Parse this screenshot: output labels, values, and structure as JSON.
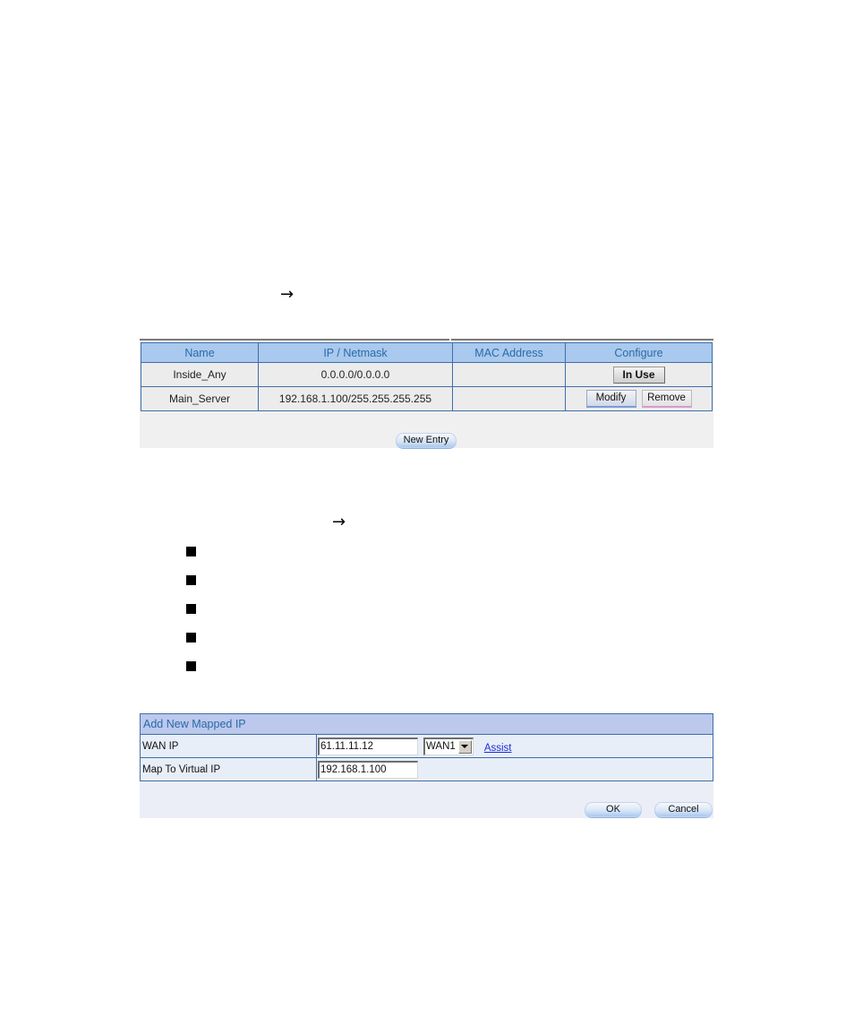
{
  "document": {
    "arrow_1": "→",
    "arrow_2": "→",
    "bullet_count": 5
  },
  "address_table": {
    "columns": [
      "Name",
      "IP / Netmask",
      "MAC Address",
      "Configure"
    ],
    "rows": [
      {
        "name": "Inside_Any",
        "ip_netmask": "0.0.0.0/0.0.0.0",
        "mac_address": "",
        "configure": {
          "in_use_label": "In Use"
        }
      },
      {
        "name": "Main_Server",
        "ip_netmask": "192.168.1.100/255.255.255.255",
        "mac_address": "",
        "configure": {
          "modify_label": "Modify",
          "remove_label": "Remove"
        }
      }
    ],
    "new_entry_label": "New Entry"
  },
  "add_mapped_ip": {
    "title": "Add New Mapped IP",
    "wan_ip": {
      "label": "WAN IP",
      "value": "61.11.11.12",
      "interface_selected": "WAN1",
      "assist_label": "Assist"
    },
    "map_to_virtual_ip": {
      "label": "Map To Virtual IP",
      "value": "192.168.1.100"
    },
    "ok_label": "OK",
    "cancel_label": "Cancel"
  },
  "colors": {
    "header_blue": "#a9c9ee",
    "header_text": "#2a6aa8",
    "border_blue": "#3f6ea8",
    "link_blue": "#1a2bdc"
  }
}
